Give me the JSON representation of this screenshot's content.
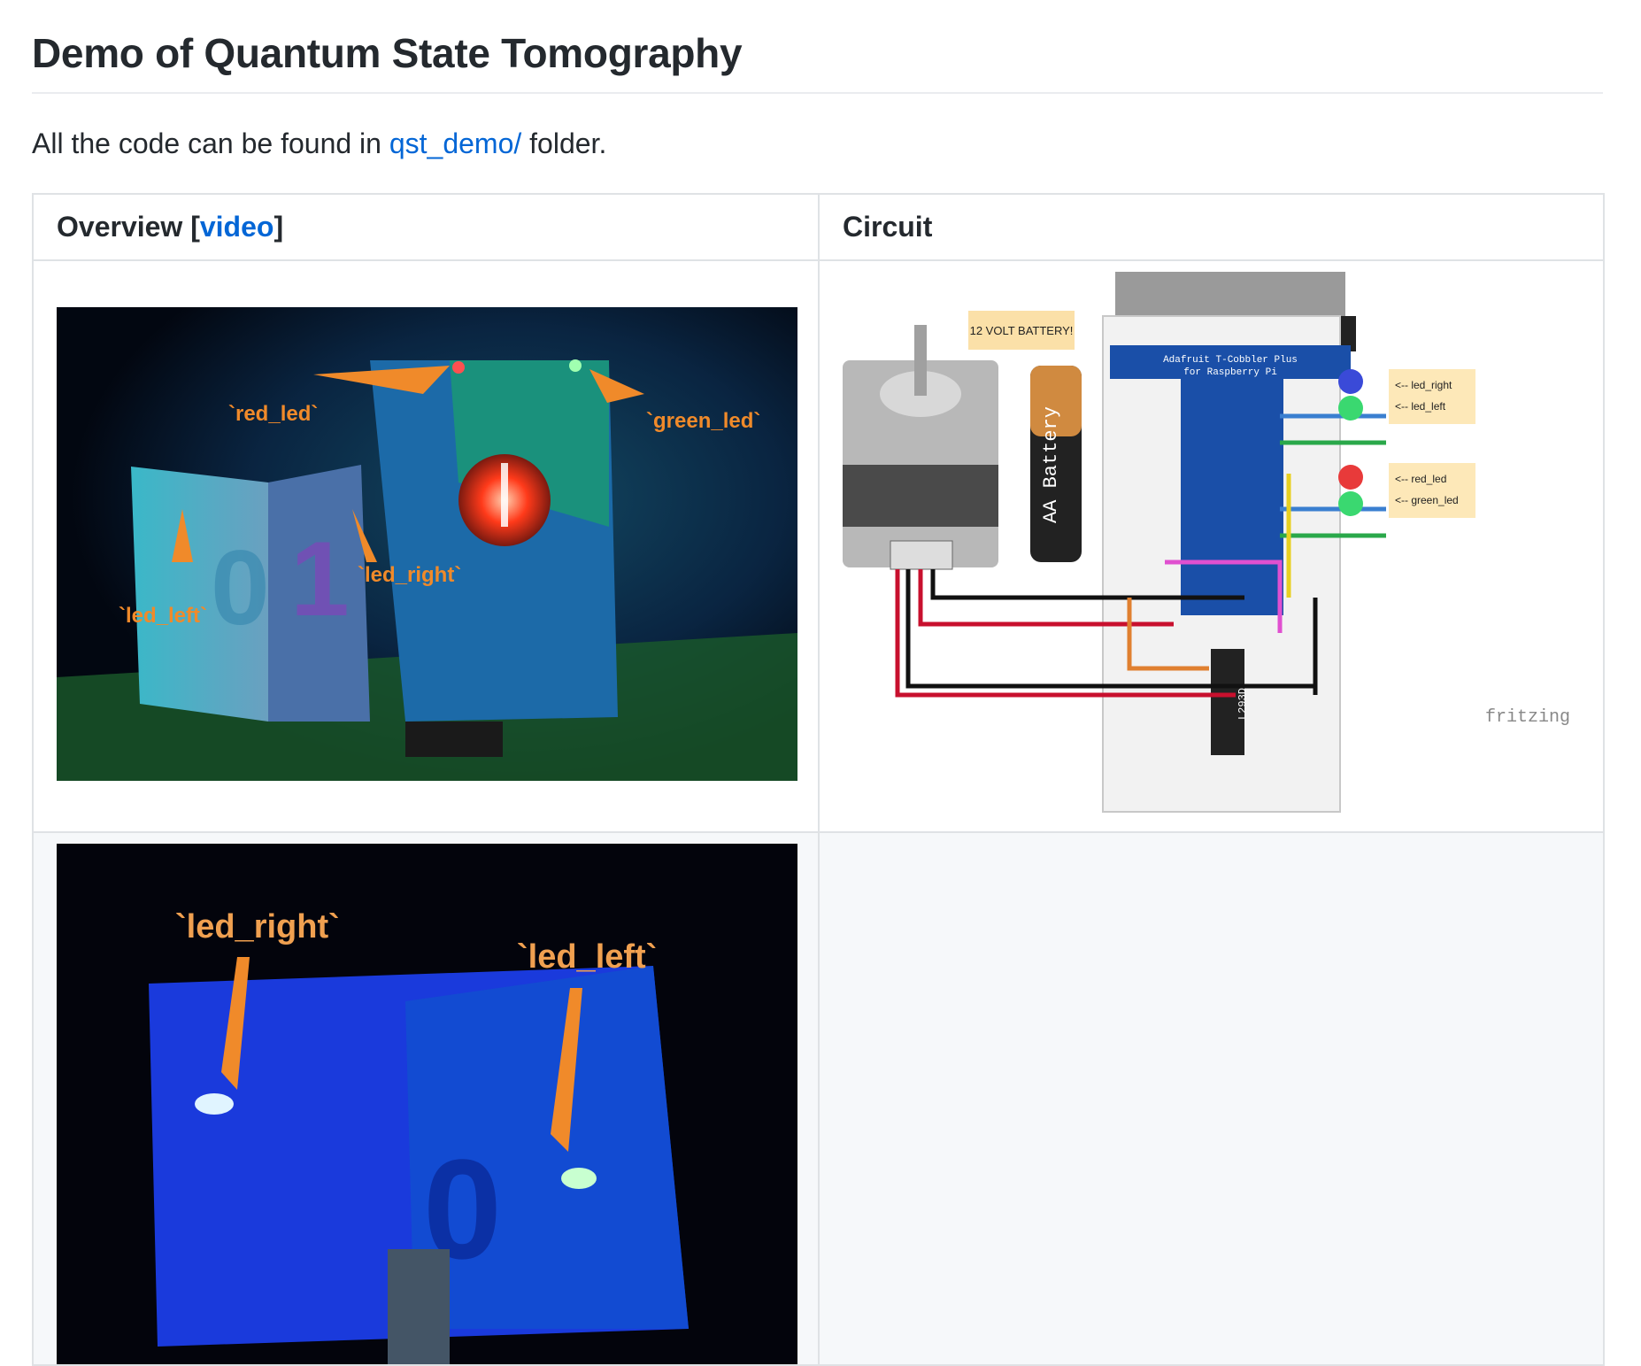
{
  "heading": "Demo of Quantum State Tomography",
  "intro": {
    "before": "All the code can be found in ",
    "link": "qst_demo/",
    "after": " folder."
  },
  "table": {
    "col1_header": "Overview [",
    "col1_link": "video",
    "col1_close": "]",
    "col2_header": "Circuit"
  },
  "photo1": {
    "labels": {
      "red_led": "`red_led`",
      "green_led": "`green_led`",
      "led_left": "`led_left`",
      "led_right": "`led_right`"
    }
  },
  "circuit": {
    "battery_note": "12 VOLT BATTERY!",
    "battery_label": "AA Battery",
    "cobbler_title": "Adafruit T-Cobbler Plus",
    "cobbler_sub": "for Raspberry Pi",
    "chip": "L293D",
    "note_led_right": "<-- led_right",
    "note_led_left": "<-- led_left",
    "note_red_led": "<-- red_led",
    "note_green_led": "<-- green_led",
    "brand": "fritzing"
  },
  "photo2": {
    "labels": {
      "led_right": "`led_right`",
      "led_left": "`led_left`"
    }
  }
}
